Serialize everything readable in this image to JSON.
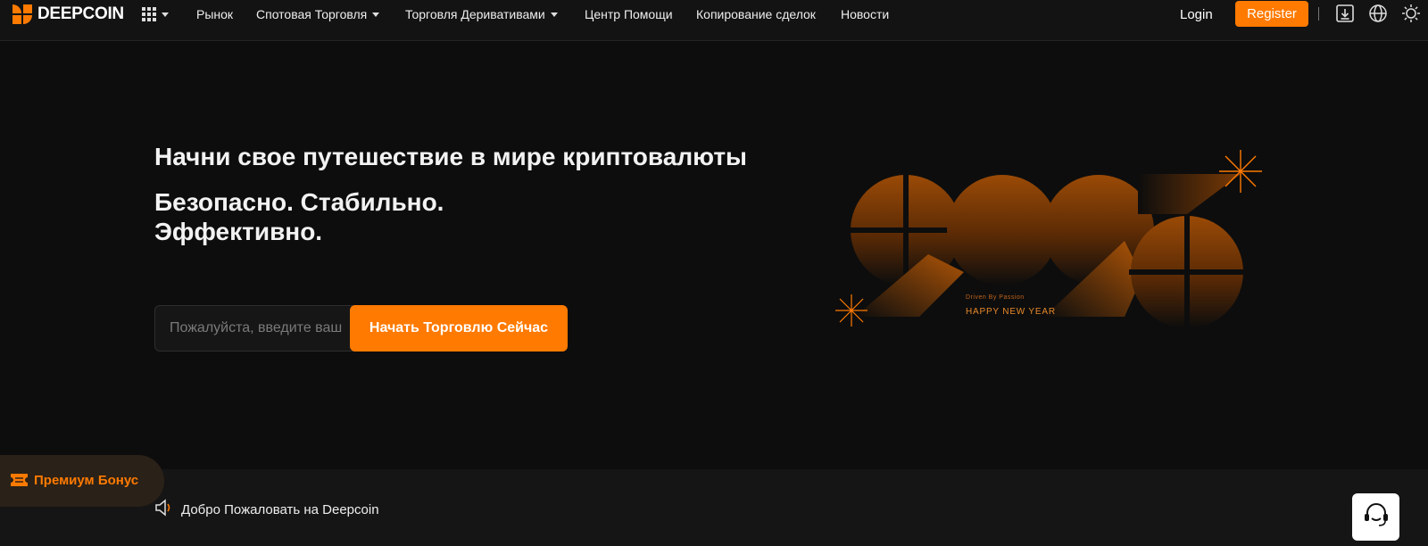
{
  "header": {
    "logo_text": "DEEPCOIN",
    "apps_icon": "grid-icon",
    "nav": [
      {
        "label": "Рынок",
        "has_caret": false
      },
      {
        "label": "Спотовая Торговля",
        "has_caret": true
      },
      {
        "label": "Торговля Деривативами",
        "has_caret": true
      },
      {
        "label": "Центр Помощи",
        "has_caret": false
      },
      {
        "label": "Копирование сделок",
        "has_caret": false
      },
      {
        "label": "Новости",
        "has_caret": false
      }
    ],
    "login_label": "Login",
    "register_label": "Register",
    "icons": [
      "download-icon",
      "globe-icon",
      "theme-toggle-icon"
    ]
  },
  "hero": {
    "title": "Начни свое путешествие в мире криптовалюты",
    "subtitle_line1": "Безопасно. Стабильно.",
    "subtitle_line2": "Эффективно.",
    "input_placeholder": "Пожалуйста, введите ваш",
    "cta_label": "Начать Торговлю Сейчас"
  },
  "art": {
    "tagline": "Driven By Passion",
    "greeting": "HAPPY NEW YEAR"
  },
  "bottom": {
    "premium_label": "Премиум Бонус",
    "announcement": "Добро Пожаловать на Deepcoin",
    "support_icon": "support-headset-icon"
  },
  "colors": {
    "accent": "#ff7a00",
    "background": "#0d0d0d",
    "header_bg": "#131313"
  }
}
